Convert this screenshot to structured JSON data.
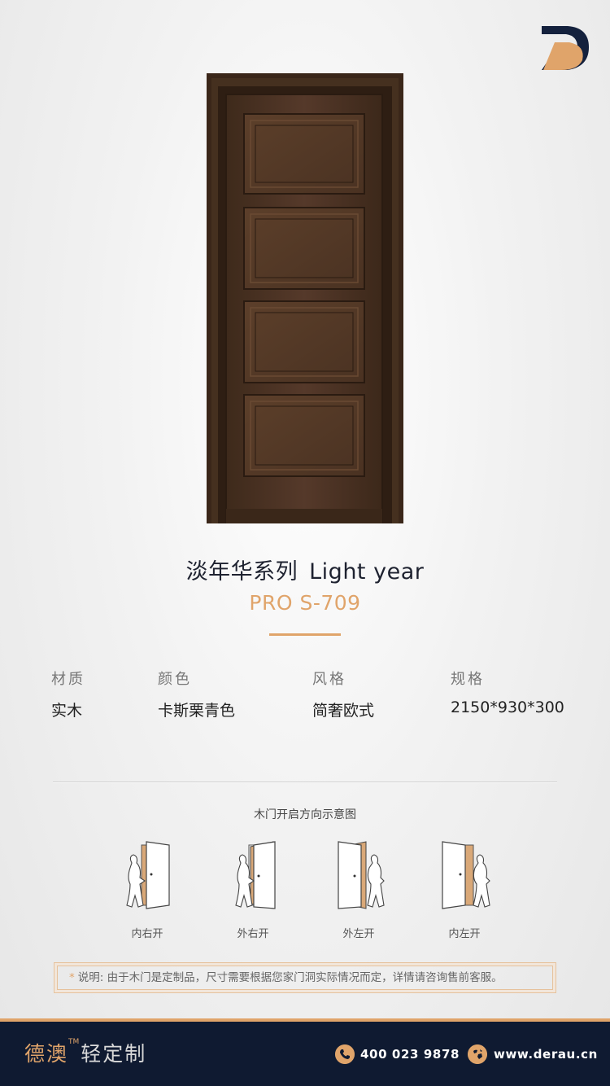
{
  "product": {
    "series_title": "淡年华系列",
    "series_en": "Light year",
    "model": "PRO S-709"
  },
  "specs": [
    {
      "label": "材质",
      "value": "实木"
    },
    {
      "label": "颜色",
      "value": "卡斯栗青色"
    },
    {
      "label": "风格",
      "value": "简奢欧式"
    },
    {
      "label": "规格",
      "value": "2150*930*300"
    }
  ],
  "diagram": {
    "title": "木门开启方向示意图",
    "items": [
      {
        "label": "内右开"
      },
      {
        "label": "外右开"
      },
      {
        "label": "外左开"
      },
      {
        "label": "内左开"
      }
    ]
  },
  "note": {
    "star": "*",
    "text": "说明: 由于木门是定制品，尺寸需要根据您家门洞实际情况而定，详情请咨询售前客服。"
  },
  "footer": {
    "brand_main": "德澳",
    "brand_tm": "TM",
    "brand_sub": "轻定制",
    "phone": "400 023 9878",
    "website": "www.derau.cn"
  },
  "colors": {
    "accent": "#e0a46a",
    "navy": "#0f1a31",
    "door_wood": "#4a3322"
  },
  "icons": [
    "brand-logo-icon",
    "phone-icon",
    "globe-icon"
  ]
}
